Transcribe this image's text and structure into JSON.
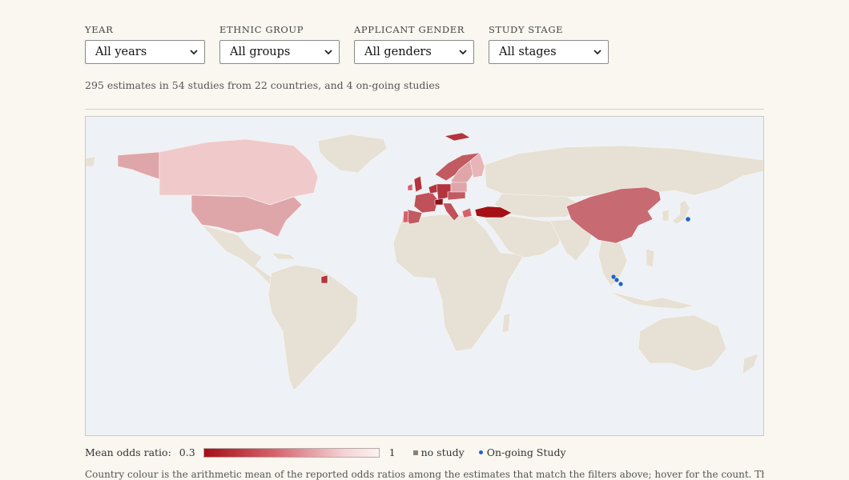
{
  "filters": [
    {
      "label": "YEAR",
      "value": "All years"
    },
    {
      "label": "ETHNIC GROUP",
      "value": "All groups"
    },
    {
      "label": "APPLICANT GENDER",
      "value": "All genders"
    },
    {
      "label": "STUDY STAGE",
      "value": "All stages"
    }
  ],
  "summary": "295 estimates in 54 studies from 22 countries, and 4 on-going studies",
  "legend": {
    "title": "Mean odds ratio:",
    "min": "0.3",
    "max": "1",
    "no_study": "no study",
    "ongoing": "On-going Study"
  },
  "footnote": "Country colour is the arithmetic mean of the reported odds ratios among the estimates that match the filters above; hover for the count. These are simple descriptive",
  "colors": {
    "ocean": "#eef1f5",
    "land_no_study": "#e6e0d5",
    "ramp_low": "#a50f15",
    "ramp_high": "#fbf1f1",
    "ongoing_dot": "#1e63c9"
  }
}
